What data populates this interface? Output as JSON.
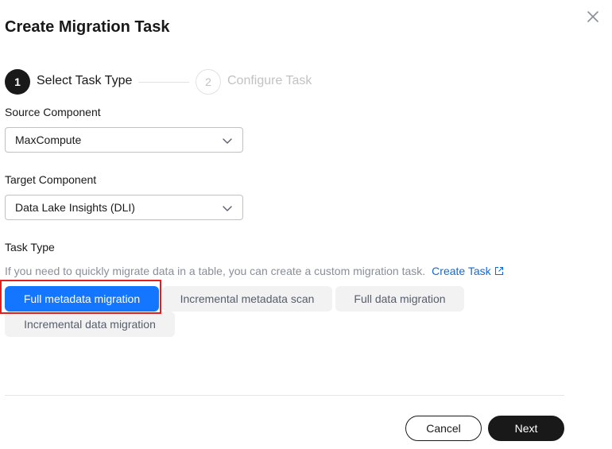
{
  "dialog": {
    "title": "Create Migration Task"
  },
  "stepper": {
    "steps": [
      {
        "number": "1",
        "label": "Select Task Type",
        "state": "active"
      },
      {
        "number": "2",
        "label": "Configure Task",
        "state": "inactive"
      }
    ]
  },
  "source_component": {
    "label": "Source Component",
    "value": "MaxCompute"
  },
  "target_component": {
    "label": "Target Component",
    "value": "Data Lake Insights (DLI)"
  },
  "task_type": {
    "label": "Task Type",
    "hint": "If you need to quickly migrate data in a table, you can create a custom migration task.",
    "create_task_link": "Create Task",
    "options": [
      {
        "label": "Full metadata migration",
        "selected": true
      },
      {
        "label": "Incremental metadata scan",
        "selected": false
      },
      {
        "label": "Full data migration",
        "selected": false
      },
      {
        "label": "Incremental data migration",
        "selected": false
      }
    ]
  },
  "footer": {
    "cancel_label": "Cancel",
    "next_label": "Next"
  },
  "colors": {
    "primary_selected": "#1476ff",
    "link": "#0f6bd9",
    "dark_button": "#191919",
    "highlight_border": "#e02020"
  }
}
